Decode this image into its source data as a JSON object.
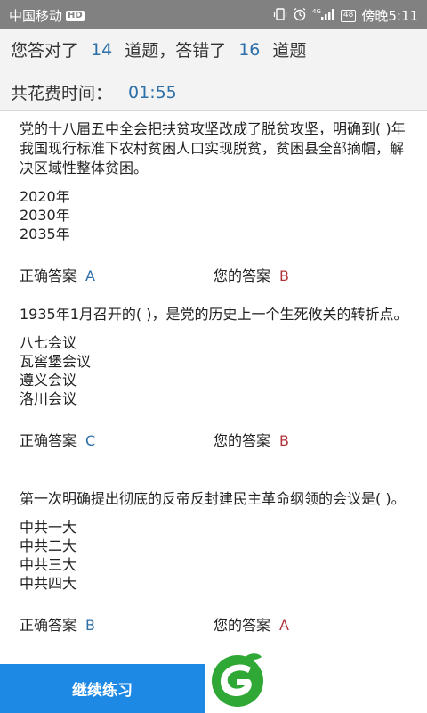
{
  "status_bar": {
    "carrier": "中国移动",
    "carrier_badge": "HD",
    "network": "4G",
    "battery": "48",
    "time": "傍晚5:11"
  },
  "summary": {
    "correct_prefix": "您答对了",
    "correct_count": "14",
    "correct_suffix": "道题，答错了",
    "wrong_count": "16",
    "wrong_suffix": "道题",
    "time_label": "共花费时间：",
    "time_value": "01:55"
  },
  "questions": [
    {
      "text": "党的十八届五中全会把扶贫攻坚改成了脱贫攻坚，明确到( )年我国现行标准下农村贫困人口实现脱贫，贫困县全部摘帽，解决区域性整体贫困。",
      "options": [
        "2020年",
        "2030年",
        "2035年"
      ],
      "correct_label": "正确答案",
      "correct_answer": "A",
      "your_label": "您的答案",
      "your_answer": "B"
    },
    {
      "text": "1935年1月召开的( )，是党的历史上一个生死攸关的转折点。",
      "options": [
        "八七会议",
        "瓦窖堡会议",
        "遵义会议",
        "洛川会议"
      ],
      "correct_label": "正确答案",
      "correct_answer": "C",
      "your_label": "您的答案",
      "your_answer": "B"
    },
    {
      "text": "第一次明确提出彻底的反帝反封建民主革命纲领的会议是( )。",
      "options": [
        "中共一大",
        "中共二大",
        "中共三大",
        "中共四大"
      ],
      "correct_label": "正确答案",
      "correct_answer": "B",
      "your_label": "您的答案",
      "your_answer": "A"
    }
  ],
  "bottom": {
    "continue_label": "继续练习"
  },
  "colors": {
    "accent": "#2d6fa8",
    "wrong": "#b0353b",
    "button": "#1e88e5",
    "logo_green": "#2fa836"
  }
}
